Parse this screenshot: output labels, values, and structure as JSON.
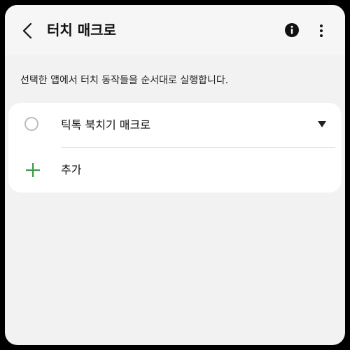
{
  "appbar": {
    "title": "터치 매크로",
    "icons": {
      "back": "chevron-left-icon",
      "info": "info-icon",
      "more": "more-vertical-icon"
    }
  },
  "description": "선택한 앱에서 터치 동작들을 순서대로 실행합니다.",
  "macro_list": {
    "items": [
      {
        "label": "틱톡 북치기 매크로",
        "selected": false,
        "icon": "dropdown-triangle-icon"
      }
    ],
    "add_label": "추가",
    "add_icon": "plus-icon"
  },
  "colors": {
    "background": "#f2f2f2",
    "card": "#ffffff",
    "accent_green": "#3d9a4a",
    "text": "#111111"
  }
}
